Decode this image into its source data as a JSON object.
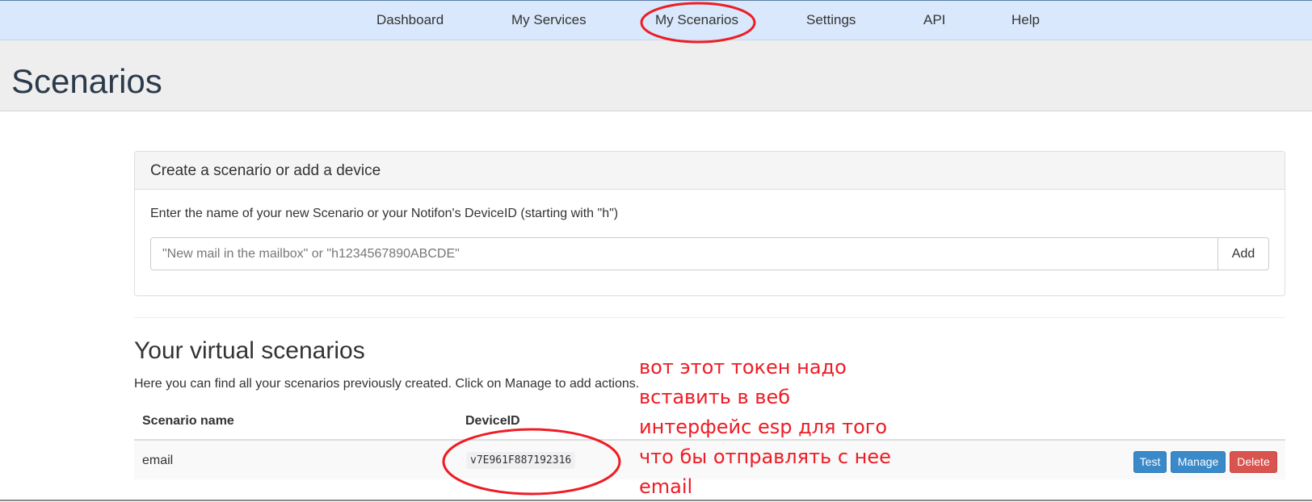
{
  "nav": {
    "items": [
      "Dashboard",
      "My Services",
      "My Scenarios",
      "Settings",
      "API",
      "Help"
    ]
  },
  "page": {
    "title": "Scenarios"
  },
  "create_panel": {
    "heading": "Create a scenario or add a device",
    "label": "Enter the name of your new Scenario or your Notifon's DeviceID (starting with \"h\")",
    "input_placeholder": "\"New mail in the mailbox\" or \"h1234567890ABCDE\"",
    "input_value": "",
    "add_label": "Add"
  },
  "scenarios": {
    "title": "Your virtual scenarios",
    "description": "Here you can find all your scenarios previously created. Click on Manage to add actions.",
    "columns": [
      "Scenario name",
      "DeviceID"
    ],
    "rows": [
      {
        "name": "email",
        "device_id": "v7E961F887192316",
        "actions": [
          "Test",
          "Manage",
          "Delete"
        ]
      }
    ]
  },
  "annotation": {
    "text": "вот этот токен надо вставить в веб интерфейс esp для того что бы отправлять с нее email",
    "color": "#ee1c24"
  },
  "colors": {
    "nav_bg": "#d9e8fc",
    "hero_bg": "#eeeeee",
    "primary": "#3a89c9",
    "danger": "#d9534f"
  }
}
